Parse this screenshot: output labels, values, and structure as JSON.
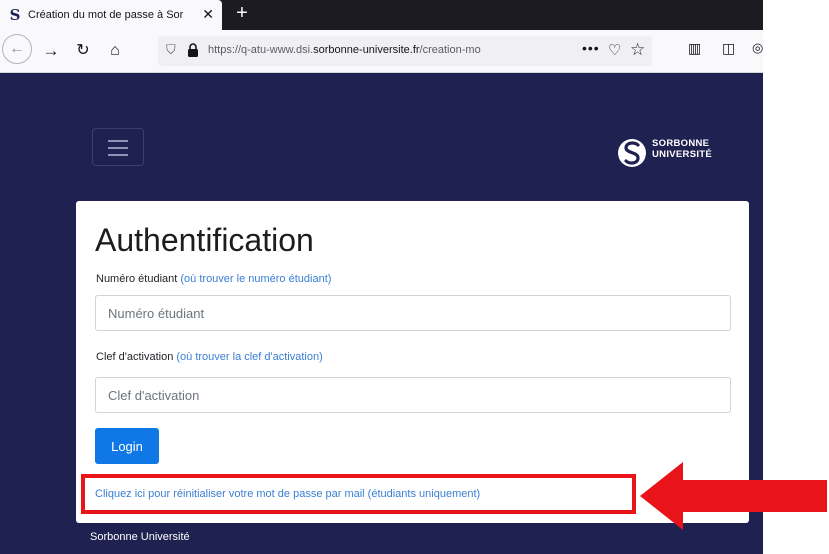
{
  "browser": {
    "tab_title": "Création du mot de passe à Sor",
    "tab_favicon": "S",
    "close_glyph": "✕",
    "newtab_glyph": "+",
    "url_prefix": "https://q-atu-www.dsi.",
    "url_domain": "sorbonne-universite.fr",
    "url_suffix": "/creation-mo",
    "more_glyph": "•••",
    "icons": [
      "back-arrow-icon",
      "forward-arrow-icon",
      "reload-icon",
      "home-icon",
      "tracking-shield-icon",
      "lock-icon",
      "pocket-icon",
      "star-icon",
      "library-icon",
      "sidebar-icon"
    ]
  },
  "header": {
    "logo_line1": "SORBONNE",
    "logo_line2": "UNIVERSITÉ"
  },
  "form": {
    "title": "Authentification",
    "student_number_label": "Numéro étudiant",
    "student_number_help": "(où trouver le numéro étudiant)",
    "student_number_placeholder": "Numéro étudiant",
    "activation_key_label": "Clef d'activation",
    "activation_key_help": "(où trouver la clef d'activation)",
    "activation_key_placeholder": "Clef d'activation",
    "login_label": "Login",
    "reset_link": "Cliquez ici pour réinitialiser votre mot de passe par mail (étudiants uniquement)"
  },
  "footer": {
    "text": "Sorbonne Université"
  },
  "colors": {
    "page_background": "#1f2150",
    "primary_button": "#0f78e6",
    "link": "#3a7fd3",
    "annotation_red": "#e8141a"
  }
}
